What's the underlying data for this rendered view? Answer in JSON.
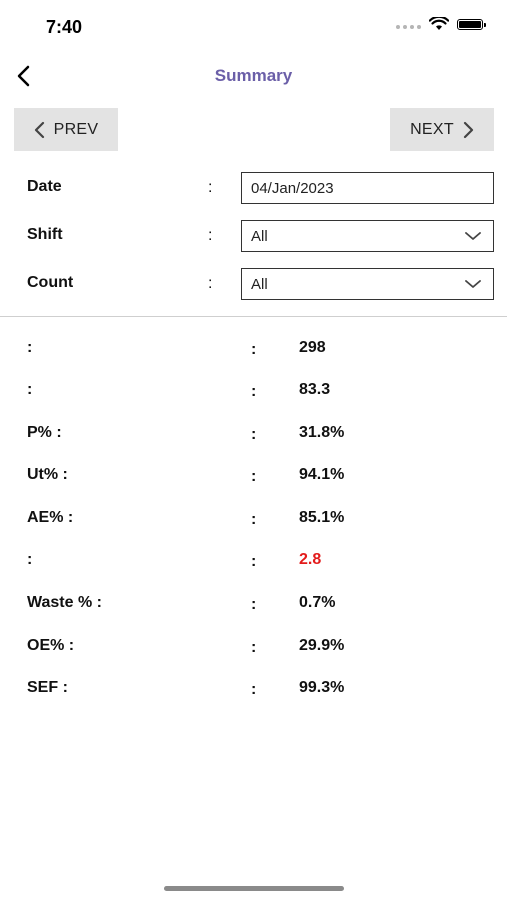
{
  "status_bar": {
    "time": "7:40",
    "icons": [
      "signal-icon",
      "wifi-icon",
      "battery-icon"
    ]
  },
  "nav": {
    "title": "Summary",
    "back_icon": "chevron-left-icon"
  },
  "pager": {
    "prev_label": "PREV",
    "next_label": "NEXT"
  },
  "form": {
    "date": {
      "label": "Date",
      "value": "04/Jan/2023"
    },
    "shift": {
      "label": "Shift",
      "value": "All"
    },
    "count": {
      "label": "Count",
      "value": "All"
    },
    "colon": ":"
  },
  "metrics": [
    {
      "label": ":",
      "colon": ":",
      "value": "298"
    },
    {
      "label": ":",
      "colon": ":",
      "value": "83.3"
    },
    {
      "label": "P% :",
      "colon": ":",
      "value": "31.8%"
    },
    {
      "label": "Ut% :",
      "colon": ":",
      "value": "94.1%"
    },
    {
      "label": "AE% :",
      "colon": ":",
      "value": "85.1%"
    },
    {
      "label": ":",
      "colon": ":",
      "value": "2.8"
    },
    {
      "label": "Waste % :",
      "colon": ":",
      "value": "0.7%"
    },
    {
      "label": "OE% :",
      "colon": ":",
      "value": "29.9%"
    },
    {
      "label": "SEF :",
      "colon": ":",
      "value": "99.3%"
    }
  ],
  "colors": {
    "title": "#6b5fa8",
    "alert_value": "#e31b1b",
    "button_bg": "#e3e3e3"
  }
}
